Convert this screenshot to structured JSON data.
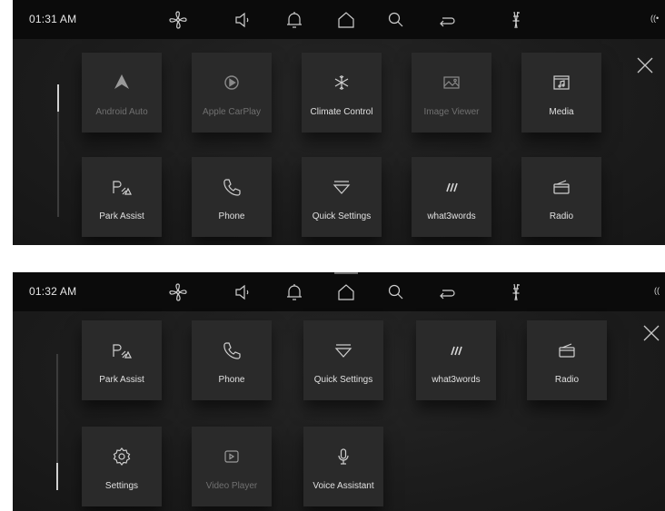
{
  "panels": [
    {
      "time": "01:31 AM",
      "tiles": [
        {
          "label": "Android Auto",
          "icon": "android-auto-icon",
          "dim": true
        },
        {
          "label": "Apple CarPlay",
          "icon": "apple-carplay-icon",
          "dim": true
        },
        {
          "label": "Climate Control",
          "icon": "climate-icon",
          "dim": false
        },
        {
          "label": "Image Viewer",
          "icon": "image-icon",
          "dim": true
        },
        {
          "label": "Media",
          "icon": "media-icon",
          "dim": false
        },
        {
          "label": "Park Assist",
          "icon": "park-assist-icon",
          "dim": false
        },
        {
          "label": "Phone",
          "icon": "phone-icon",
          "dim": false
        },
        {
          "label": "Quick Settings",
          "icon": "quick-settings-icon",
          "dim": false
        },
        {
          "label": "what3words",
          "icon": "what3words-icon",
          "dim": false
        },
        {
          "label": "Radio",
          "icon": "radio-icon",
          "dim": false
        }
      ],
      "scroll_position": 0.0
    },
    {
      "time": "01:32 AM",
      "tiles": [
        {
          "label": "Park Assist",
          "icon": "park-assist-icon",
          "dim": false
        },
        {
          "label": "Phone",
          "icon": "phone-icon",
          "dim": false
        },
        {
          "label": "Quick Settings",
          "icon": "quick-settings-icon",
          "dim": false
        },
        {
          "label": "what3words",
          "icon": "what3words-icon",
          "dim": false
        },
        {
          "label": "Radio",
          "icon": "radio-icon",
          "dim": false
        },
        {
          "label": "Settings",
          "icon": "settings-icon",
          "dim": false
        },
        {
          "label": "Video Player",
          "icon": "video-icon",
          "dim": true
        },
        {
          "label": "Voice Assistant",
          "icon": "microphone-icon",
          "dim": false
        }
      ],
      "scroll_position": 1.0
    }
  ],
  "toolbar_icons": [
    "fan-icon",
    "volume-icon",
    "bell-icon",
    "home-icon",
    "search-icon",
    "return-icon",
    "seat-heat-icon",
    "connection-icon"
  ],
  "colors": {
    "background": "#1c1c1c",
    "topbar": "#0b0b0b",
    "tile": "#2a2a2a",
    "text": "#e0e0e0",
    "dim_text": "#707070"
  }
}
